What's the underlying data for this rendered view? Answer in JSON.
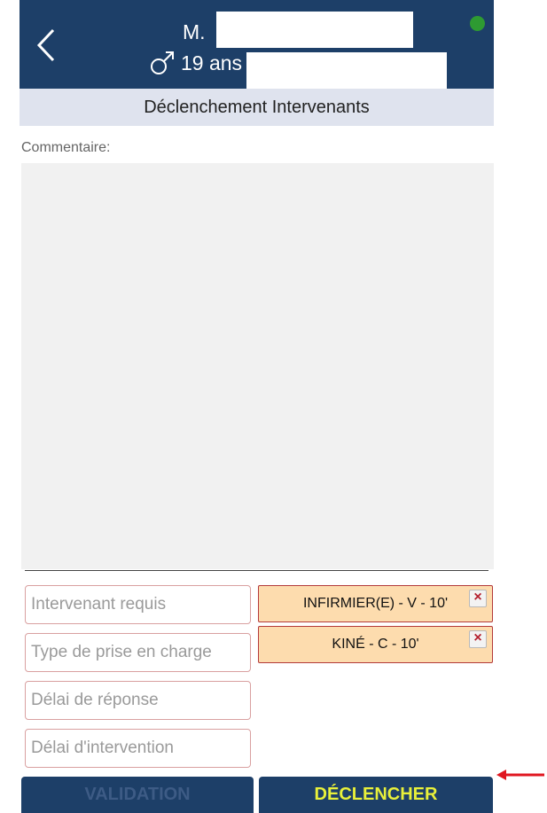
{
  "header": {
    "patient_name": "M. ",
    "patient_age": "19 ans",
    "status_color": "#2e9a32"
  },
  "subheader": {
    "title": "Déclenchement Intervenants"
  },
  "comment": {
    "label": "Commentaire:",
    "value": ""
  },
  "fields": [
    {
      "placeholder": "Intervenant requis"
    },
    {
      "placeholder": "Type de prise en charge"
    },
    {
      "placeholder": "Délai de réponse"
    },
    {
      "placeholder": "Délai d'intervention"
    }
  ],
  "chips": [
    {
      "label": "INFIRMIER(E) - V - 10'",
      "close": "×"
    },
    {
      "label": "KINÉ - C - 10'",
      "close": "×"
    }
  ],
  "buttons": {
    "validation": "VALIDATION",
    "declencher": "DÉCLENCHER"
  },
  "colors": {
    "header_bg": "#1d3f68",
    "subheader_bg": "#dfe3ee",
    "chip_bg": "#fddcae",
    "declencher_text": "#e8f03a",
    "annotation_arrow": "#e0161f"
  },
  "icons": {
    "back": "chevron-left-icon",
    "gender": "male-symbol-icon",
    "status": "status-dot-icon",
    "chip_close": "close-icon"
  }
}
